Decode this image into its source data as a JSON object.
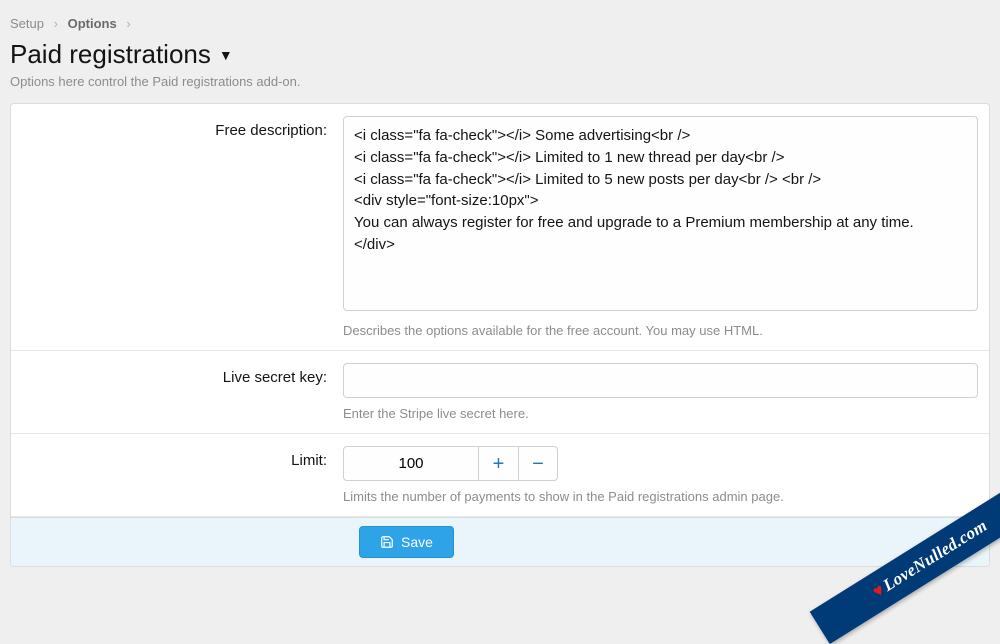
{
  "breadcrumb": {
    "setup": "Setup",
    "options": "Options"
  },
  "page": {
    "title": "Paid registrations",
    "subtitle": "Options here control the Paid registrations add-on."
  },
  "fields": {
    "free_desc": {
      "label": "Free description:",
      "value": "<i class=\"fa fa-check\"></i> Some advertising<br />\n<i class=\"fa fa-check\"></i> Limited to 1 new thread per day<br />\n<i class=\"fa fa-check\"></i> Limited to 5 new posts per day<br /> <br />\n<div style=\"font-size:10px\">\nYou can always register for free and upgrade to a Premium membership at any time.\n</div>",
      "hint": "Describes the options available for the free account. You may use HTML."
    },
    "live_secret": {
      "label": "Live secret key:",
      "value": "",
      "hint": "Enter the Stripe live secret here."
    },
    "limit": {
      "label": "Limit:",
      "value": "100",
      "hint": "Limits the number of payments to show in the Paid registrations admin page."
    }
  },
  "footer": {
    "save_label": "Save"
  },
  "watermark": {
    "text": "LoveNulled.com"
  }
}
